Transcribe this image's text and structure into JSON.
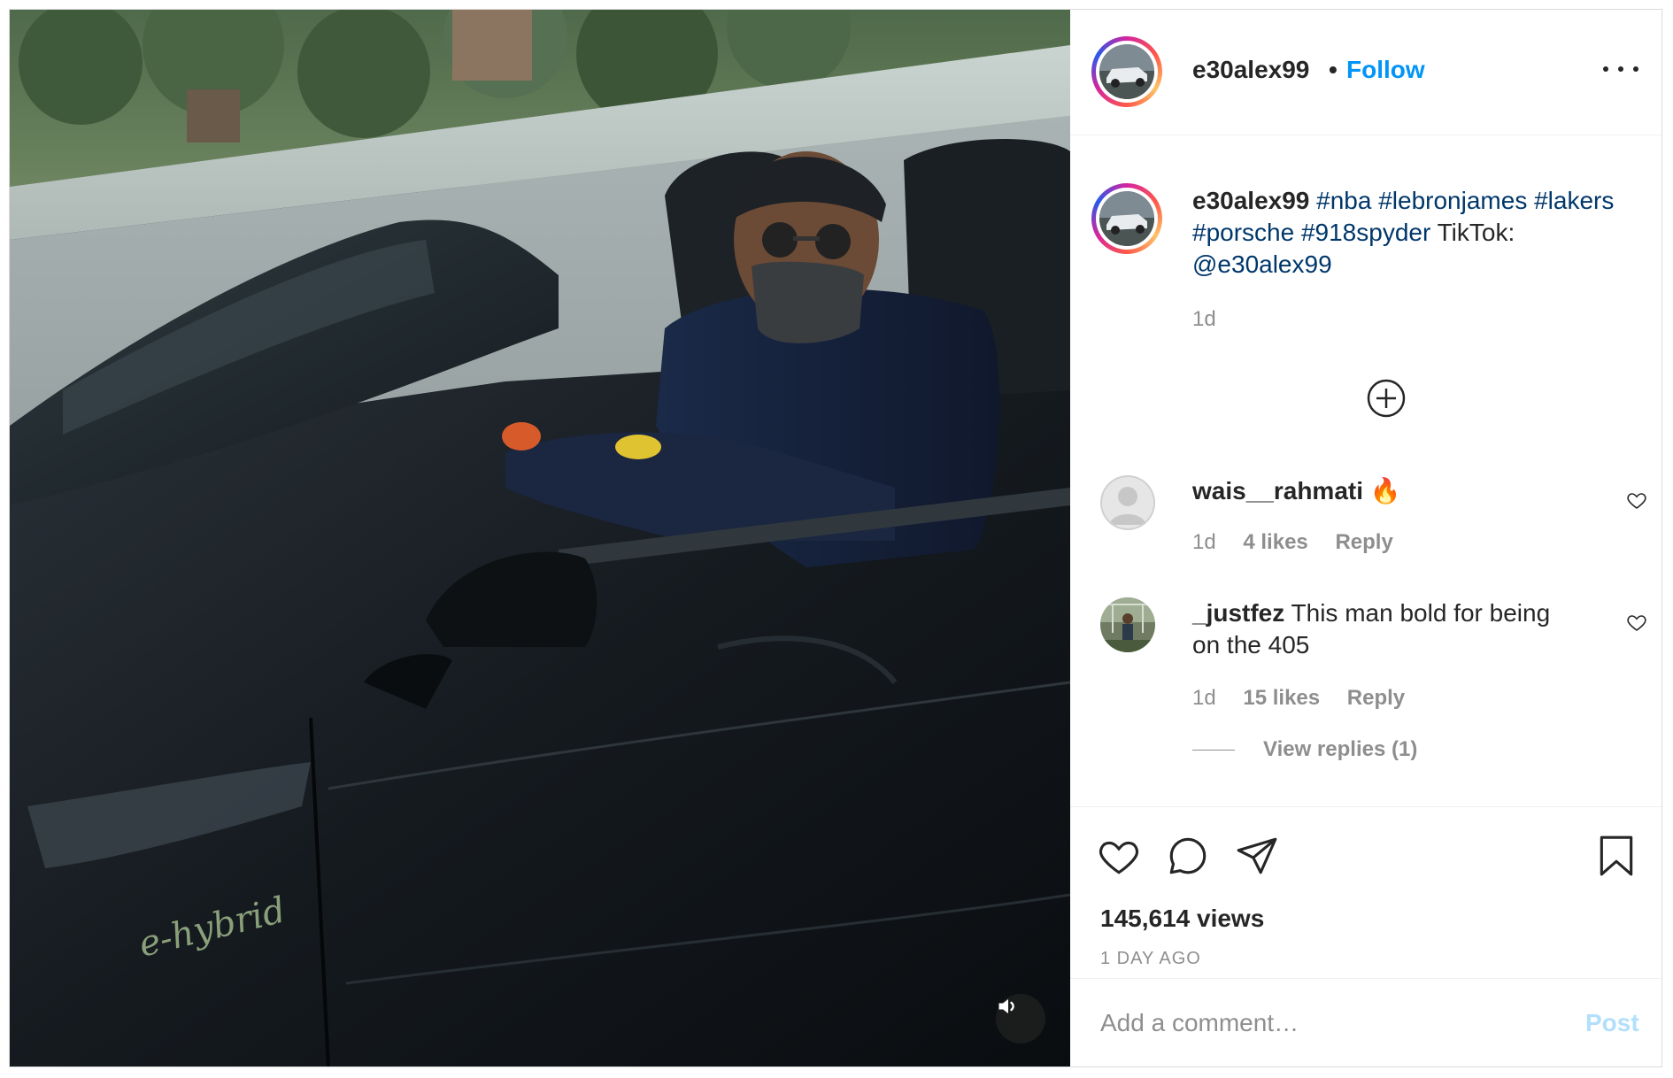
{
  "post": {
    "author": "e30alex99",
    "separator": "•",
    "follow_label": "Follow",
    "more_icon": "more-options-icon",
    "caption": {
      "username": "e30alex99",
      "hashtags": [
        "#nba",
        "#lebronjames",
        "#lakers",
        "#porsche",
        "#918spyder"
      ],
      "text": "TikTok:",
      "mention": "@e30alex99",
      "time": "1d"
    },
    "load_more_icon": "add-circle-icon",
    "comments": [
      {
        "username": "wais__rahmati",
        "text": "🔥",
        "time": "1d",
        "likes": "4 likes",
        "reply": "Reply"
      },
      {
        "username": "_justfez",
        "text": "This man bold for being on the 405",
        "time": "1d",
        "likes": "15 likes",
        "reply": "Reply",
        "view_replies": "View replies (1)"
      }
    ],
    "views": "145,614 views",
    "date": "1 DAY AGO",
    "comment_placeholder": "Add a comment…",
    "post_label": "Post",
    "icons": [
      "heart-icon",
      "comment-icon",
      "share-icon",
      "bookmark-icon",
      "volume-icon"
    ],
    "colors": {
      "link": "#0095f6",
      "hashtag": "#00376b",
      "muted": "#8e8e8e",
      "post_disabled": "#b2dffc"
    }
  },
  "media": {
    "badge_text": "e-hybrid"
  }
}
